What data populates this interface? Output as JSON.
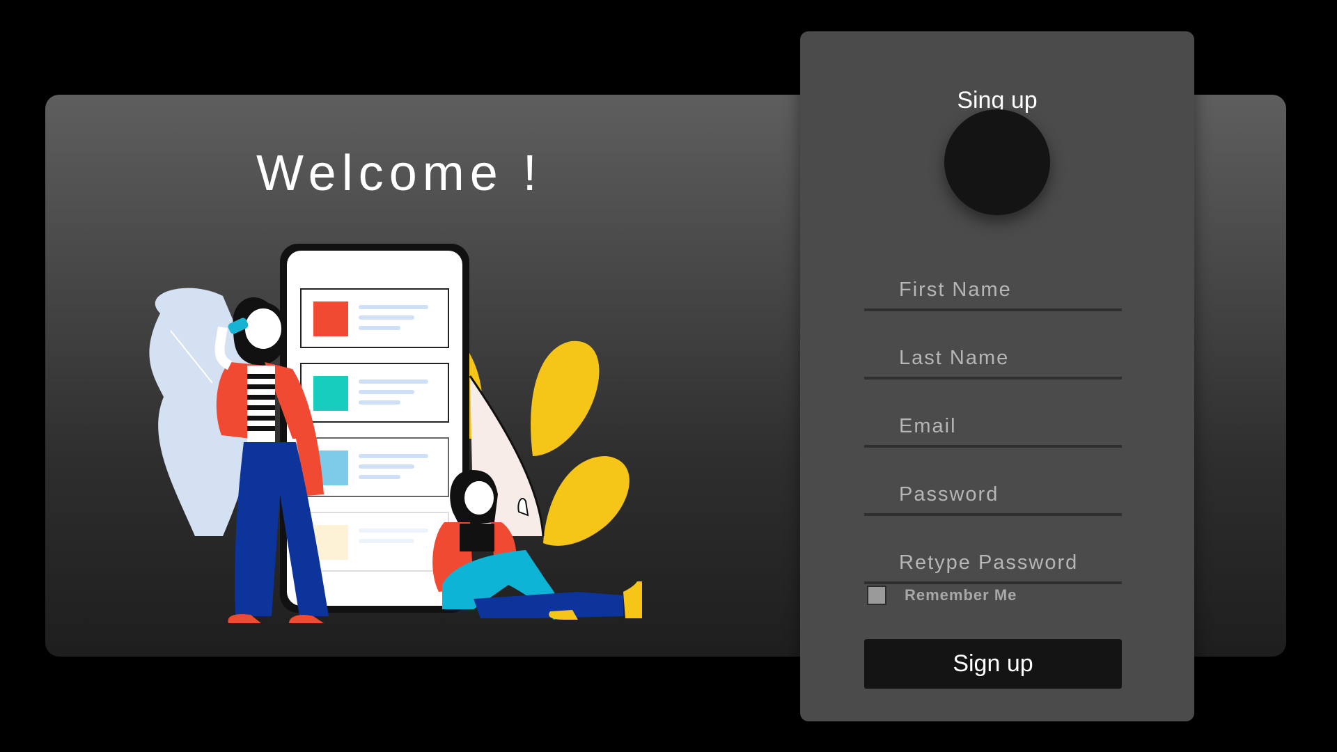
{
  "welcome": {
    "heading": "Welcome !"
  },
  "signup": {
    "title": "Sing up",
    "fields": {
      "first_name": {
        "placeholder": "First Name",
        "value": ""
      },
      "last_name": {
        "placeholder": "Last Name",
        "value": ""
      },
      "email": {
        "placeholder": "Email",
        "value": ""
      },
      "password": {
        "placeholder": "Password",
        "value": ""
      },
      "retype_password": {
        "placeholder": "Retype Password",
        "value": ""
      }
    },
    "remember_label": "Remember Me",
    "remember_checked": false,
    "button_label": "Sign up"
  },
  "colors": {
    "page_bg": "#000000",
    "card_bg": "#4b4b4b",
    "avatar": "#141414",
    "button_bg": "#141414",
    "accent_yellow": "#f5c518",
    "accent_red": "#f04a33",
    "accent_blue": "#0c349a",
    "accent_cyan": "#0db4d6"
  }
}
